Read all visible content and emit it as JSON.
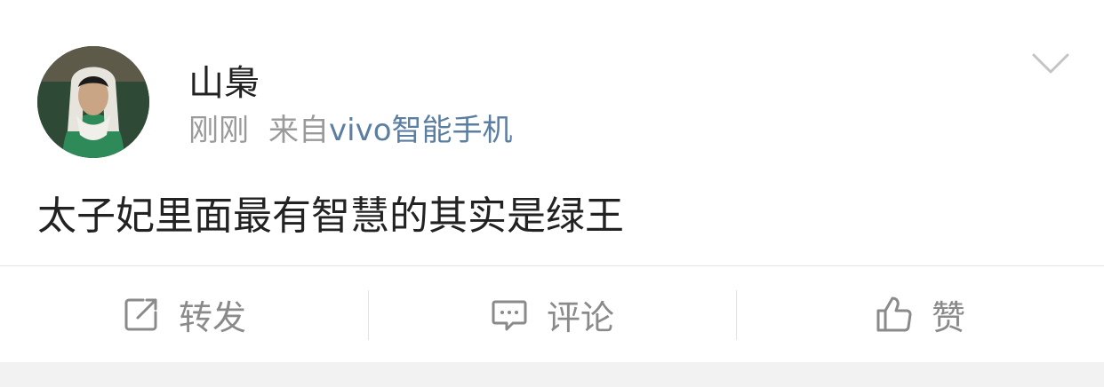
{
  "post": {
    "username": "山梟",
    "time": "刚刚",
    "source_prefix": "来自",
    "source_name": "vivo智能手机",
    "content": "太子妃里面最有智慧的其实是绿王"
  },
  "actions": {
    "repost": {
      "label": "转发",
      "icon": "repost-icon"
    },
    "comment": {
      "label": "评论",
      "icon": "comment-icon"
    },
    "like": {
      "label": "赞",
      "icon": "thumbs-up-icon"
    }
  },
  "colors": {
    "source_link": "#5b7ea3",
    "meta_gray": "#9a9a9a",
    "action_gray": "#8a8a8a",
    "text": "#222222"
  }
}
